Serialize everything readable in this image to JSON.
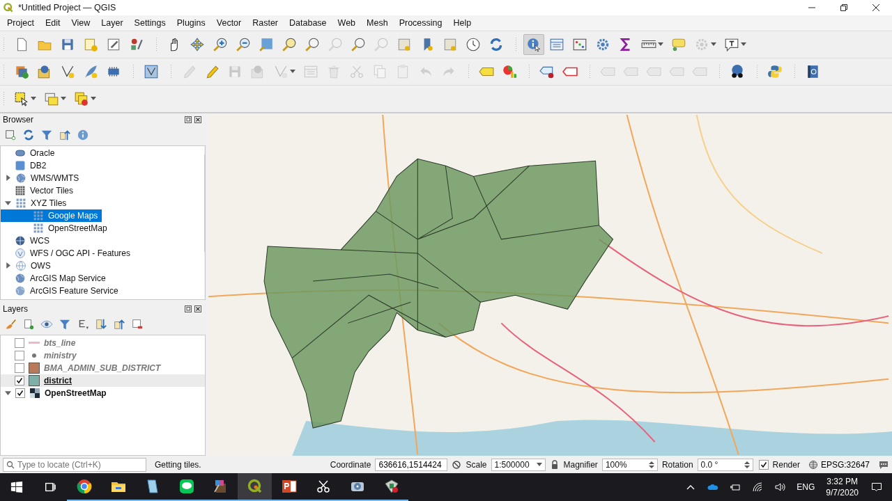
{
  "window": {
    "title": "*Untitled Project — QGIS"
  },
  "menu": [
    "Project",
    "Edit",
    "View",
    "Layer",
    "Settings",
    "Plugins",
    "Vector",
    "Raster",
    "Database",
    "Web",
    "Mesh",
    "Processing",
    "Help"
  ],
  "toolbars": [
    {
      "groups": [
        {
          "buttons": [
            {
              "disabled": false,
              "dropdown": false,
              "selected": false
            },
            {
              "disabled": false,
              "dropdown": false,
              "selected": false
            },
            {
              "disabled": false,
              "dropdown": false,
              "selected": false
            },
            {
              "disabled": false,
              "dropdown": false,
              "selected": false
            },
            {
              "disabled": false,
              "dropdown": false,
              "selected": false
            },
            {
              "disabled": false,
              "dropdown": false,
              "selected": false
            }
          ]
        },
        {
          "buttons": [
            {
              "disabled": false,
              "dropdown": false,
              "selected": false
            },
            {
              "disabled": false,
              "dropdown": false,
              "selected": false
            },
            {
              "disabled": false,
              "dropdown": false,
              "selected": false
            },
            {
              "disabled": false,
              "dropdown": false,
              "selected": false
            },
            {
              "disabled": false,
              "dropdown": false,
              "selected": false
            },
            {
              "disabled": false,
              "dropdown": false,
              "selected": false
            },
            {
              "disabled": false,
              "dropdown": false,
              "selected": false
            },
            {
              "disabled": true,
              "dropdown": false,
              "selected": false
            },
            {
              "disabled": false,
              "dropdown": false,
              "selected": false
            },
            {
              "disabled": true,
              "dropdown": false,
              "selected": false
            },
            {
              "disabled": false,
              "dropdown": false,
              "selected": false
            },
            {
              "disabled": false,
              "dropdown": false,
              "selected": false
            },
            {
              "disabled": false,
              "dropdown": false,
              "selected": false
            },
            {
              "disabled": false,
              "dropdown": false,
              "selected": false
            },
            {
              "disabled": false,
              "dropdown": false,
              "selected": false
            }
          ]
        },
        {
          "buttons": [
            {
              "disabled": false,
              "dropdown": false,
              "selected": true
            },
            {
              "disabled": false,
              "dropdown": false,
              "selected": false
            },
            {
              "disabled": false,
              "dropdown": false,
              "selected": false
            },
            {
              "disabled": false,
              "dropdown": false,
              "selected": false
            },
            {
              "disabled": false,
              "dropdown": false,
              "selected": false
            },
            {
              "disabled": false,
              "dropdown": true,
              "selected": false
            },
            {
              "disabled": false,
              "dropdown": false,
              "selected": false
            },
            {
              "disabled": true,
              "dropdown": true,
              "selected": false
            },
            {
              "disabled": false,
              "dropdown": true,
              "selected": false
            }
          ]
        }
      ]
    },
    {
      "groups": [
        {
          "buttons": [
            {
              "disabled": false,
              "dropdown": false,
              "selected": false
            },
            {
              "disabled": false,
              "dropdown": false,
              "selected": false
            },
            {
              "disabled": false,
              "dropdown": false,
              "selected": false
            },
            {
              "disabled": false,
              "dropdown": false,
              "selected": false
            },
            {
              "disabled": false,
              "dropdown": false,
              "selected": false
            }
          ]
        },
        {
          "buttons": [
            {
              "disabled": false,
              "dropdown": false,
              "selected": false
            }
          ]
        },
        {
          "buttons": [
            {
              "disabled": true,
              "dropdown": false,
              "selected": false
            },
            {
              "disabled": false,
              "dropdown": false,
              "selected": false
            },
            {
              "disabled": true,
              "dropdown": false,
              "selected": false
            },
            {
              "disabled": true,
              "dropdown": false,
              "selected": false
            },
            {
              "disabled": true,
              "dropdown": true,
              "selected": false
            },
            {
              "disabled": true,
              "dropdown": false,
              "selected": false
            },
            {
              "disabled": true,
              "dropdown": false,
              "selected": false
            },
            {
              "disabled": true,
              "dropdown": false,
              "selected": false
            },
            {
              "disabled": true,
              "dropdown": false,
              "selected": false
            },
            {
              "disabled": true,
              "dropdown": false,
              "selected": false
            },
            {
              "disabled": true,
              "dropdown": false,
              "selected": false
            },
            {
              "disabled": true,
              "dropdown": false,
              "selected": false
            }
          ]
        },
        {
          "buttons": [
            {
              "disabled": false,
              "dropdown": false,
              "selected": false
            },
            {
              "disabled": false,
              "dropdown": false,
              "selected": false
            }
          ]
        },
        {
          "buttons": [
            {
              "disabled": false,
              "dropdown": false,
              "selected": false
            },
            {
              "disabled": false,
              "dropdown": false,
              "selected": false
            }
          ]
        },
        {
          "buttons": [
            {
              "disabled": true,
              "dropdown": false,
              "selected": false
            },
            {
              "disabled": true,
              "dropdown": false,
              "selected": false
            },
            {
              "disabled": true,
              "dropdown": false,
              "selected": false
            },
            {
              "disabled": true,
              "dropdown": false,
              "selected": false
            },
            {
              "disabled": true,
              "dropdown": false,
              "selected": false
            }
          ]
        },
        {
          "buttons": [
            {
              "disabled": false,
              "dropdown": false,
              "selected": false
            }
          ]
        },
        {
          "buttons": [
            {
              "disabled": false,
              "dropdown": false,
              "selected": false
            }
          ]
        },
        {
          "buttons": [
            {
              "disabled": false,
              "dropdown": false,
              "selected": false
            }
          ]
        }
      ]
    },
    {
      "groups": [
        {
          "buttons": [
            {
              "disabled": false,
              "dropdown": true,
              "selected": false
            },
            {
              "disabled": false,
              "dropdown": true,
              "selected": false
            },
            {
              "disabled": false,
              "dropdown": true,
              "selected": false
            }
          ]
        }
      ]
    }
  ],
  "browser": {
    "title": "Browser",
    "items": [
      {
        "label": "Oracle",
        "selected": false
      },
      {
        "label": "DB2",
        "selected": false
      },
      {
        "label": "WMS/WMTS",
        "expanded": false,
        "selected": false
      },
      {
        "label": "Vector Tiles",
        "selected": false
      },
      {
        "label": "XYZ Tiles",
        "expanded": true,
        "selected": false,
        "children": [
          {
            "label": "Google Maps",
            "selected": true
          },
          {
            "label": "OpenStreetMap",
            "selected": false
          }
        ]
      },
      {
        "label": "WCS",
        "selected": false
      },
      {
        "label": "WFS / OGC API - Features",
        "selected": false
      },
      {
        "label": "OWS",
        "expanded": false,
        "selected": false
      },
      {
        "label": "ArcGIS Map Service",
        "selected": false
      },
      {
        "label": "ArcGIS Feature Service",
        "selected": false
      }
    ]
  },
  "layers": {
    "title": "Layers",
    "items": [
      {
        "name": "bts_line",
        "kind": "line",
        "color": "#f0b8c4",
        "checked": false,
        "selected": false
      },
      {
        "name": "ministry",
        "kind": "point",
        "color": "#777777",
        "checked": false,
        "selected": false
      },
      {
        "name": "BMA_ADMIN_SUB_DISTRICT",
        "kind": "fill",
        "color": "#b87a5a",
        "checked": false,
        "selected": false
      },
      {
        "name": "district",
        "kind": "fill",
        "color": "#7fb0a8",
        "checked": true,
        "selected": true
      },
      {
        "name": "OpenStreetMap",
        "kind": "raster",
        "checked": true,
        "selected": false,
        "expanded": true
      }
    ]
  },
  "status_bar": {
    "locate_placeholder": "Type to locate (Ctrl+K)",
    "message": "Getting tiles.",
    "coordinate_label": "Coordinate",
    "coordinate": "636616,1514424",
    "scale_label": "Scale",
    "scale": "1:500000",
    "magnifier_label": "Magnifier",
    "magnifier": "100%",
    "rotation_label": "Rotation",
    "rotation": "0.0 °",
    "render_label": "Render",
    "render": true,
    "crs": "EPSG:32647"
  },
  "taskbar": {
    "apps": [
      {
        "running": true,
        "selected": false
      },
      {
        "running": true,
        "selected": false
      },
      {
        "running": true,
        "selected": false
      },
      {
        "running": true,
        "selected": false
      },
      {
        "running": true,
        "selected": false
      },
      {
        "running": true,
        "selected": true
      },
      {
        "running": true,
        "selected": false
      },
      {
        "running": true,
        "selected": false
      },
      {
        "running": true,
        "selected": false
      },
      {
        "running": true,
        "selected": false
      }
    ],
    "language": "ENG",
    "time": "3:32 PM",
    "date": "9/7/2020"
  }
}
